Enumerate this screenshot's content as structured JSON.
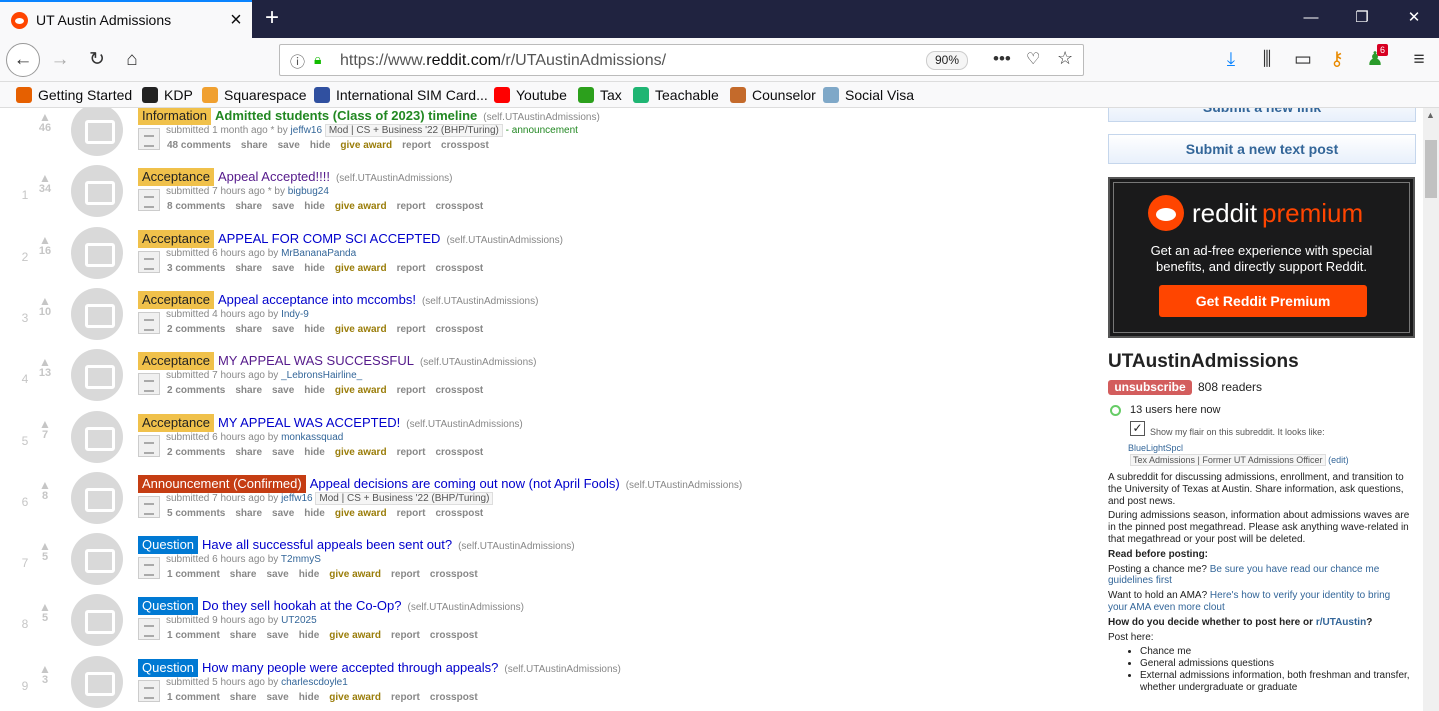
{
  "browser": {
    "tab_title": "UT Austin Admissions",
    "url_prefix": "https://www.",
    "url_domain": "reddit.com",
    "url_path": "/r/UTAustinAdmissions/",
    "zoom": "90%",
    "badge_count": "6"
  },
  "bookmarks": [
    {
      "label": "Getting Started",
      "color": "#e66000"
    },
    {
      "label": "KDP",
      "color": "#222222"
    },
    {
      "label": "Squarespace",
      "color": "#f0a030"
    },
    {
      "label": "International SIM Card...",
      "color": "#3050a0"
    },
    {
      "label": "Youtube",
      "color": "#ff0000"
    },
    {
      "label": "Tax",
      "color": "#2ca01c"
    },
    {
      "label": "Teachable",
      "color": "#1fb573"
    },
    {
      "label": "Counselor",
      "color": "#c46a2b"
    },
    {
      "label": "Social Visa",
      "color": "#7fa8c8"
    }
  ],
  "posts": [
    {
      "rank": "",
      "score": "46",
      "flair": "Information",
      "flair_bg": "#f0c14b",
      "flair_fg": "#222222",
      "title": "Admitted students (Class of 2023) timeline",
      "title_color": "#228822",
      "domain": "(self.UTAustinAdmissions)",
      "time": "submitted 1 month ago * by",
      "author": "jeffw16",
      "mod": "Mod | CS + Business '22 (BHP/Turing)",
      "extra": "- announcement",
      "comments": "48 comments"
    },
    {
      "rank": "1",
      "score": "34",
      "flair": "Acceptance",
      "flair_bg": "#f0c14b",
      "flair_fg": "#222222",
      "title": "Appeal Accepted!!!!",
      "title_color": "#551a8b",
      "domain": "(self.UTAustinAdmissions)",
      "time": "submitted 7 hours ago * by",
      "author": "bigbug24",
      "mod": "",
      "extra": "",
      "comments": "8 comments"
    },
    {
      "rank": "2",
      "score": "16",
      "flair": "Acceptance",
      "flair_bg": "#f0c14b",
      "flair_fg": "#222222",
      "title": "APPEAL FOR COMP SCI ACCEPTED",
      "title_color": "#0000cc",
      "domain": "(self.UTAustinAdmissions)",
      "time": "submitted 6 hours ago by",
      "author": "MrBananaPanda",
      "mod": "",
      "extra": "",
      "comments": "3 comments"
    },
    {
      "rank": "3",
      "score": "10",
      "flair": "Acceptance",
      "flair_bg": "#f0c14b",
      "flair_fg": "#222222",
      "title": "Appeal acceptance into mccombs!",
      "title_color": "#0000cc",
      "domain": "(self.UTAustinAdmissions)",
      "time": "submitted 4 hours ago by",
      "author": "Indy-9",
      "mod": "",
      "extra": "",
      "comments": "2 comments"
    },
    {
      "rank": "4",
      "score": "13",
      "flair": "Acceptance",
      "flair_bg": "#f0c14b",
      "flair_fg": "#222222",
      "title": "MY APPEAL WAS SUCCESSFUL",
      "title_color": "#551a8b",
      "domain": "(self.UTAustinAdmissions)",
      "time": "submitted 7 hours ago by",
      "author": "_LebronsHairline_",
      "mod": "",
      "extra": "",
      "comments": "2 comments"
    },
    {
      "rank": "5",
      "score": "7",
      "flair": "Acceptance",
      "flair_bg": "#f0c14b",
      "flair_fg": "#222222",
      "title": "MY APPEAL WAS ACCEPTED!",
      "title_color": "#0000cc",
      "domain": "(self.UTAustinAdmissions)",
      "time": "submitted 6 hours ago by",
      "author": "monkassquad",
      "mod": "",
      "extra": "",
      "comments": "2 comments"
    },
    {
      "rank": "6",
      "score": "8",
      "flair": "Announcement (Confirmed)",
      "flair_bg": "#c53d13",
      "flair_fg": "#ffffff",
      "title": "Appeal decisions are coming out now (not April Fools)",
      "title_color": "#0000cc",
      "domain": "(self.UTAustinAdmissions)",
      "time": "submitted 7 hours ago by",
      "author": "jeffw16",
      "mod": "Mod | CS + Business '22 (BHP/Turing)",
      "extra": "",
      "comments": "5 comments"
    },
    {
      "rank": "7",
      "score": "5",
      "flair": "Question",
      "flair_bg": "#0079d3",
      "flair_fg": "#ffffff",
      "title": "Have all successful appeals been sent out?",
      "title_color": "#0000cc",
      "domain": "(self.UTAustinAdmissions)",
      "time": "submitted 6 hours ago by",
      "author": "T2mmyS",
      "mod": "",
      "extra": "",
      "comments": "1 comment"
    },
    {
      "rank": "8",
      "score": "5",
      "flair": "Question",
      "flair_bg": "#0079d3",
      "flair_fg": "#ffffff",
      "title": "Do they sell hookah at the Co-Op?",
      "title_color": "#0000cc",
      "domain": "(self.UTAustinAdmissions)",
      "time": "submitted 9 hours ago by",
      "author": "UT2025",
      "mod": "",
      "extra": "",
      "comments": "1 comment"
    },
    {
      "rank": "9",
      "score": "3",
      "flair": "Question",
      "flair_bg": "#0079d3",
      "flair_fg": "#ffffff",
      "title": "How many people were accepted through appeals?",
      "title_color": "#0000cc",
      "domain": "(self.UTAustinAdmissions)",
      "time": "submitted 5 hours ago by",
      "author": "charlescdoyle1",
      "mod": "",
      "extra": "",
      "comments": "1 comment"
    }
  ],
  "post_actions": {
    "share": "share",
    "save": "save",
    "hide": "hide",
    "award": "give award",
    "report": "report",
    "crosspost": "crosspost"
  },
  "sidebar": {
    "submit_link": "Submit a new link",
    "submit_text": "Submit a new text post",
    "premium": {
      "word1": "reddit",
      "word2": "premium",
      "text": "Get an ad-free experience with special benefits, and directly support Reddit.",
      "button": "Get Reddit Premium"
    },
    "subreddit": "UTAustinAdmissions",
    "unsubscribe": "unsubscribe",
    "readers": "808 readers",
    "online": "13 users here now",
    "flair_text": "Show my flair on this subreddit. It looks like:",
    "flair_user": "BlueLightSpcl",
    "flair_tag": "Tex Admissions | Former UT Admissions Officer",
    "flair_edit": "(edit)",
    "desc1": "A subreddit for discussing admissions, enrollment, and transition to the University of Texas at Austin. Share information, ask questions, and post news.",
    "desc2": "During admissions season, information about admissions waves are in the pinned post megathread. Please ask anything wave-related in that megathread or your post will be deleted.",
    "read_before": "Read before posting:",
    "chance_q": "Posting a chance me? ",
    "chance_link": "Be sure you have read our chance me guidelines first",
    "ama_q": "Want to hold an AMA? ",
    "ama_link": "Here's how to verify your identity to bring your AMA even more clout",
    "decide_q": "How do you decide whether to post here or ",
    "decide_link": "r/UTAustin",
    "decide_end": "?",
    "post_here": "Post here:",
    "list": [
      "Chance me",
      "General admissions questions",
      "External admissions information, both freshman and transfer, whether undergraduate or graduate"
    ]
  }
}
